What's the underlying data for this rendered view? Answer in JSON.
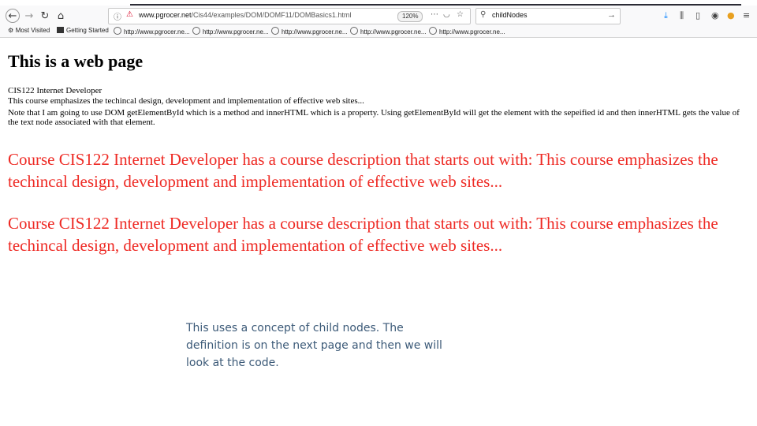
{
  "browser": {
    "url_prefix": "www.pgrocer.net",
    "url_path": "/Cis44/examples/DOM/DOMF11/DOMBasics1.html",
    "zoom": "120%",
    "search_text": "childNodes"
  },
  "bookmarks": [
    {
      "label": "Most Visited"
    },
    {
      "label": "Getting Started"
    },
    {
      "label": "http://www.pgrocer.ne..."
    },
    {
      "label": "http://www.pgrocer.ne..."
    },
    {
      "label": "http://www.pgrocer.ne..."
    },
    {
      "label": "http://www.pgrocer.ne..."
    },
    {
      "label": "http://www.pgrocer.ne..."
    }
  ],
  "page": {
    "heading": "This is a web page",
    "course_title": "CIS122 Internet Developer",
    "course_desc": "This course emphasizes the techincal design, development and implementation of effective web sites...",
    "note": "Note that I am going to use DOM getElementById which is a method and innerHTML which is a property. Using getElementById will get the element with the sepeified id and then innerHTML gets the value of the text node associated with that element.",
    "output1": "Course CIS122 Internet Developer has a course description that starts out with: This course emphasizes the techincal design, development and implementation of effective web sites...",
    "output2": "Course CIS122 Internet Developer has a course description that starts out with: This course emphasizes the techincal design, development and implementation of effective web sites..."
  },
  "caption": "This uses a concept of child nodes. The definition is on the next page and then we will look at the code.",
  "colors": {
    "output_text": "#ee2a24",
    "caption_text": "#3c5a78"
  }
}
